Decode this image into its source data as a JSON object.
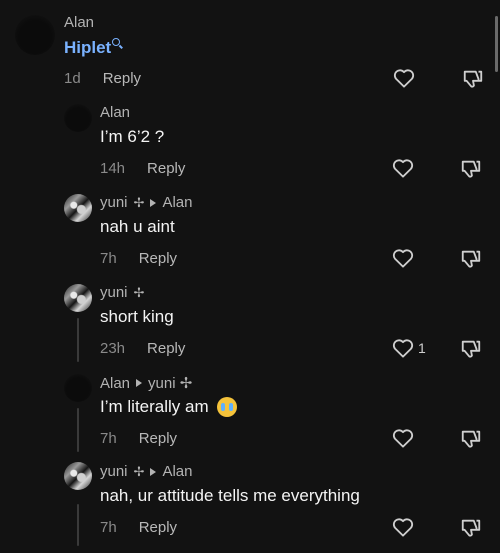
{
  "comments": [
    {
      "author": "Alan",
      "body_link": "Hiplet",
      "time": "1d",
      "reply_label": "Reply"
    },
    {
      "author": "Alan",
      "body": "I’m 6’2 ?",
      "time": "14h",
      "reply_label": "Reply"
    },
    {
      "author": "yuni",
      "author_suffix": "✢",
      "reply_to": "Alan",
      "body": "nah u aint",
      "time": "7h",
      "reply_label": "Reply"
    },
    {
      "author": "yuni",
      "author_suffix": "✢",
      "body": "short king",
      "time": "23h",
      "reply_label": "Reply",
      "like_count": "1"
    },
    {
      "author": "Alan",
      "reply_to": "yuni ✢",
      "body": "I’m literally am",
      "emoji": "loudly-crying-face",
      "time": "7h",
      "reply_label": "Reply"
    },
    {
      "author": "yuni",
      "author_suffix": "✢",
      "reply_to": "Alan",
      "body": "nah, ur attitude tells me everything",
      "time": "7h",
      "reply_label": "Reply"
    }
  ],
  "colors": {
    "background": "#121212",
    "link": "#7ab2ff",
    "meta": "#8a8a8a"
  }
}
